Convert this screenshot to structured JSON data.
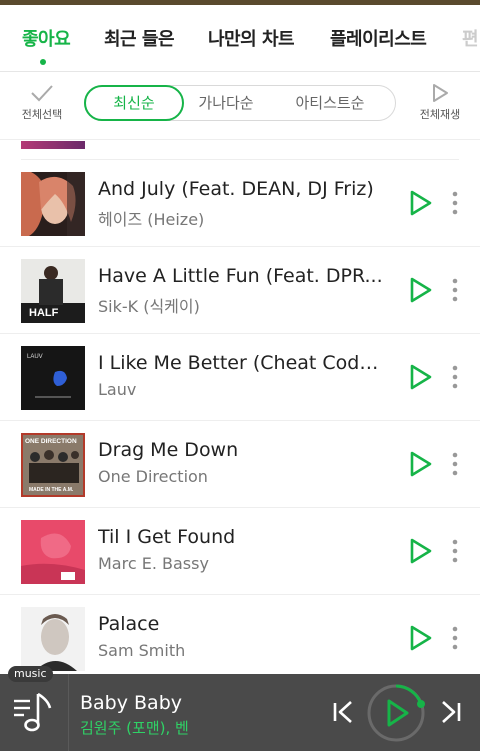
{
  "tabs": [
    {
      "label": "좋아요"
    },
    {
      "label": "최근 들은"
    },
    {
      "label": "나만의 차트"
    },
    {
      "label": "플레이리스트"
    },
    {
      "label": "편"
    }
  ],
  "toolbar": {
    "select_all_label": "전체선택",
    "play_all_label": "전체재생",
    "sort_options": [
      "최신순",
      "가나다순",
      "아티스트순"
    ],
    "active_sort": "최신순"
  },
  "songs": [
    {
      "title": "And July (Feat. DEAN, DJ Friz)",
      "artist": "헤이즈 (Heize)"
    },
    {
      "title": "Have A Little Fun (Feat. DPR...",
      "artist": "Sik-K (식케이)"
    },
    {
      "title": "I Like Me Better (Cheat Code...",
      "artist": "Lauv"
    },
    {
      "title": "Drag Me Down",
      "artist": "One Direction"
    },
    {
      "title": "Til I Get Found",
      "artist": "Marc E. Bassy"
    },
    {
      "title": "Palace",
      "artist": "Sam Smith"
    }
  ],
  "album_art_text": {
    "have_a_little_fun": "HALF",
    "i_like_me_better": "LAUV",
    "drag_me_down_top": "ONE DIRECTION",
    "drag_me_down_bottom": "MADE IN THE A.M."
  },
  "player": {
    "tag": "music",
    "title": "Baby Baby",
    "artist": "김원주 (포맨), 벤"
  },
  "colors": {
    "accent": "#16b448",
    "player_bg": "#4a4a4a",
    "player_artist": "#2fd266"
  }
}
